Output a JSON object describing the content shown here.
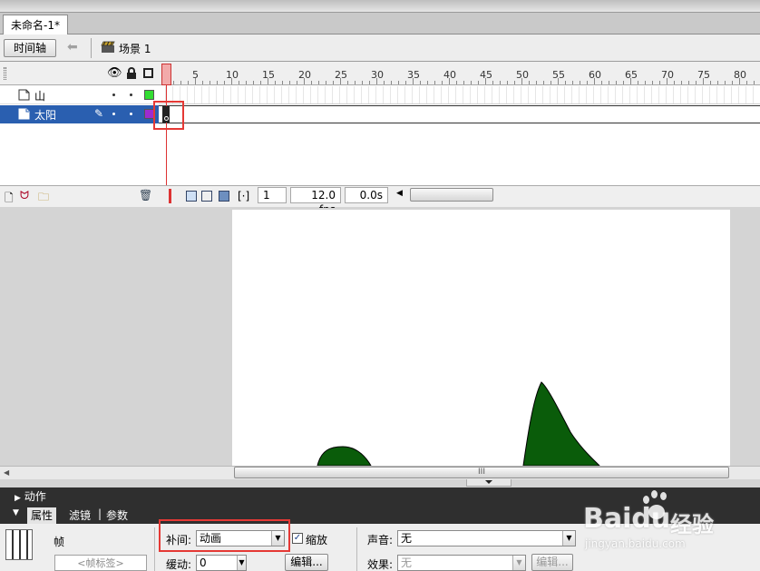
{
  "document_tab": "未命名-1*",
  "toolbar": {
    "timeline_button": "时间轴",
    "scene_label": "场景 1"
  },
  "ruler": {
    "ticks": [
      "1",
      "5",
      "10",
      "15",
      "20",
      "25",
      "30",
      "35",
      "40",
      "45",
      "50",
      "55",
      "60",
      "65",
      "70",
      "75",
      "80"
    ]
  },
  "layers": [
    {
      "name": "山",
      "color": "#33dd33"
    },
    {
      "name": "太阳",
      "color": "#9c2bd0"
    }
  ],
  "timeline_footer": {
    "current_frame": "1",
    "fps": "12.0 fps",
    "time": "0.0s"
  },
  "stage": {
    "scroll_grip": "III"
  },
  "panels": {
    "actions": "动作",
    "tabs": [
      "属性",
      "滤镜",
      "参数"
    ]
  },
  "properties": {
    "frame_label": "帧",
    "frame_label_placeholder": "<帧标签>",
    "tween_label": "补间:",
    "tween_value": "动画",
    "scale_label": "缩放",
    "ease_label": "缓动:",
    "ease_value": "0",
    "edit_button": "编辑...",
    "sound_label": "声音:",
    "sound_value": "无",
    "effect_label": "效果:",
    "effect_value": "无",
    "edit_button2": "编辑..."
  },
  "watermark": {
    "brand": "Baidu",
    "suffix": "经验",
    "url": "jingyan.baidu.com"
  },
  "colors": {
    "accent_red": "#e53935",
    "layer_selected": "#2a5fb0",
    "hill_green": "#0a5c0a"
  }
}
